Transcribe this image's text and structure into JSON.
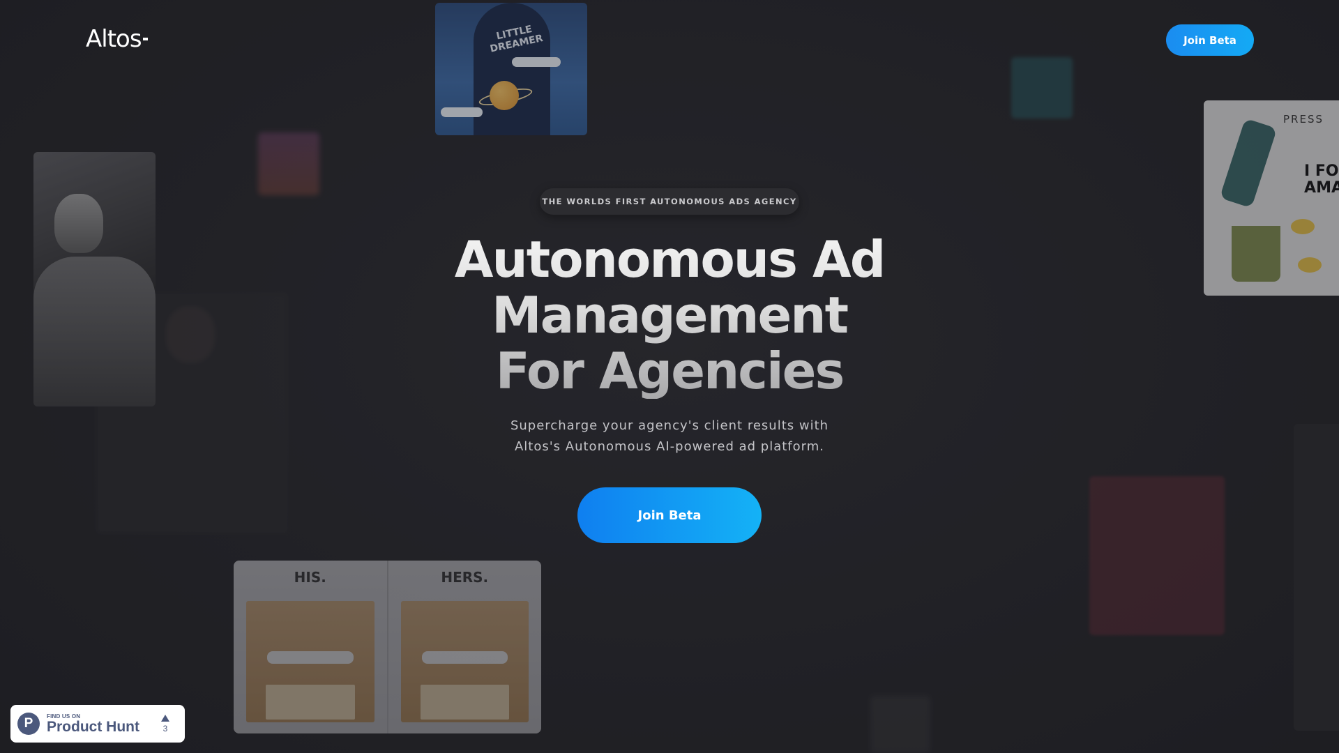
{
  "header": {
    "logo_text": "Altos",
    "join_label": "Join Beta"
  },
  "hero": {
    "eyebrow": "THE WORLDS FIRST AUTONOMOUS ADS AGENCY",
    "title_lines": [
      "Autonomous Ad",
      "Management",
      "For Agencies"
    ],
    "subtitle_lines": [
      "Supercharge your agency's client results with",
      "Altos's Autonomous AI-powered ad platform."
    ],
    "cta_label": "Join Beta"
  },
  "ads": {
    "dreamer_title": "LITTLE DREAMER",
    "press_label": "PRESS",
    "press_headline": "I FO\nAMA",
    "his_label": "HIS.",
    "hers_label": "HERS."
  },
  "product_hunt": {
    "small_text": "FIND US ON",
    "big_text": "Product Hunt",
    "votes": "3"
  },
  "colors": {
    "background": "#242428",
    "accent_start": "#0f7ff0",
    "accent_end": "#14b2f6",
    "product_hunt": "#4b587c"
  }
}
